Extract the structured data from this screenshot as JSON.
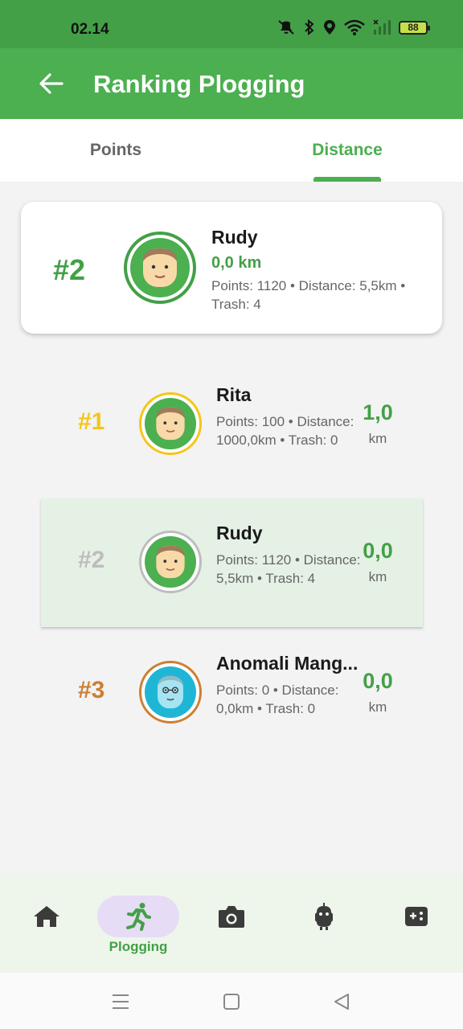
{
  "status_bar": {
    "time": "02.14",
    "battery": "88",
    "icons": [
      "mute-icon",
      "bluetooth-icon",
      "location-icon",
      "wifi-icon",
      "signal-icon",
      "battery-icon"
    ]
  },
  "app_bar": {
    "title": "Ranking Plogging",
    "back_icon": "arrow-back-icon"
  },
  "tabs": [
    {
      "label": "Points",
      "active": false
    },
    {
      "label": "Distance",
      "active": true
    }
  ],
  "my_rank_card": {
    "rank": "#2",
    "name": "Rudy",
    "distance": "0,0 km",
    "details": "Points: 1120 • Distance: 5,5km • Trash: 4"
  },
  "leaderboard": [
    {
      "rank": "#1",
      "name": "Rita",
      "details": "Points: 100 • Distance: 1000,0km • Trash: 0",
      "value": "1,0",
      "unit": "km",
      "rank_color": "#f5c518",
      "ring_color": "#f5c518",
      "avatar_color": "#4caf50",
      "highlight": false
    },
    {
      "rank": "#2",
      "name": "Rudy",
      "details": "Points: 1120 • Distance: 5,5km • Trash: 4",
      "value": "0,0",
      "unit": "km",
      "rank_color": "#bdbdbd",
      "ring_color": "#bdbdbd",
      "avatar_color": "#4caf50",
      "highlight": true
    },
    {
      "rank": "#3",
      "name": "Anomali Mang...",
      "details": "Points: 0 • Distance: 0,0km • Trash: 0",
      "value": "0,0",
      "unit": "km",
      "rank_color": "#cd7f32",
      "ring_color": "#cd7f32",
      "avatar_color": "#1fb6d6",
      "highlight": false
    }
  ],
  "bottom_nav": [
    {
      "icon": "home-icon",
      "label": "",
      "active": false
    },
    {
      "icon": "running-icon",
      "label": "Plogging",
      "active": true
    },
    {
      "icon": "camera-icon",
      "label": "",
      "active": false
    },
    {
      "icon": "robot-icon",
      "label": "",
      "active": false
    },
    {
      "icon": "gamepad-icon",
      "label": "",
      "active": false
    }
  ],
  "colors": {
    "primary": "#4caf50",
    "status_bar": "#43a047",
    "gold": "#f5c518",
    "silver": "#bdbdbd",
    "bronze": "#cd7f32",
    "highlight_row": "#e6f1e5",
    "active_nav_pill": "#e6dcf5"
  }
}
